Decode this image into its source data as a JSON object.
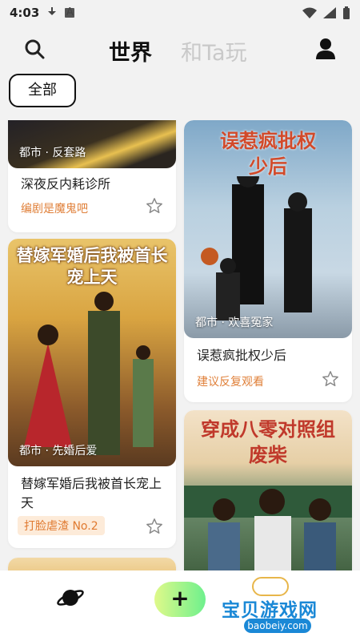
{
  "status": {
    "time": "4:03",
    "a_icon": "A"
  },
  "header": {
    "tab_world": "世界",
    "tab_ta": "和Ta玩"
  },
  "filter": {
    "chip": "全部"
  },
  "cards": [
    {
      "tag": "都市 · 反套路",
      "title": "深夜反内耗诊所",
      "sub": "编剧是魔鬼吧"
    },
    {
      "tag": "都市 · 欢喜冤家",
      "title": "误惹疯批权少后",
      "sub": "建议反复观看",
      "cover_text": "误惹疯批权少后"
    },
    {
      "tag": "都市 · 先婚后爱",
      "title": "替嫁军婚后我被首长宠上天",
      "sub": "打脸虐渣 No.2",
      "cover_text": "替嫁军婚后我被首长宠上天"
    },
    {
      "cover_text": "穿成八零对照组废柴"
    }
  ],
  "watermark": {
    "text": "宝贝游戏网",
    "url": "baobeiy.com"
  },
  "nav": {
    "plus": "+"
  },
  "colors": {
    "accent_green": "#6ef08d",
    "orange": "#e0803a",
    "gold": "#f5d27a"
  }
}
